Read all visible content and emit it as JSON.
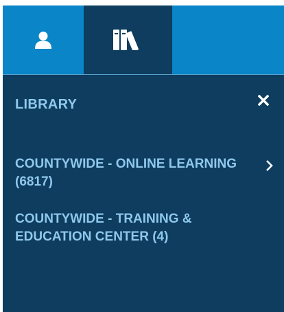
{
  "tabs": [
    {
      "name": "user",
      "icon": "user-icon",
      "active": false
    },
    {
      "name": "library",
      "icon": "library-books-icon",
      "active": true
    }
  ],
  "header": {
    "title": "LIBRARY",
    "close_icon": "close-icon"
  },
  "list": {
    "items": [
      {
        "label": "COUNTYWIDE - ONLINE LEARNING (6817)",
        "has_children": true
      },
      {
        "label": "COUNTYWIDE - TRAINING & EDUCATION CENTER (4)",
        "has_children": false
      }
    ]
  },
  "colors": {
    "tabbar": "#0a85c8",
    "panel": "#0e3d5f",
    "text": "#8fc8ec",
    "icon": "#ffffff"
  }
}
